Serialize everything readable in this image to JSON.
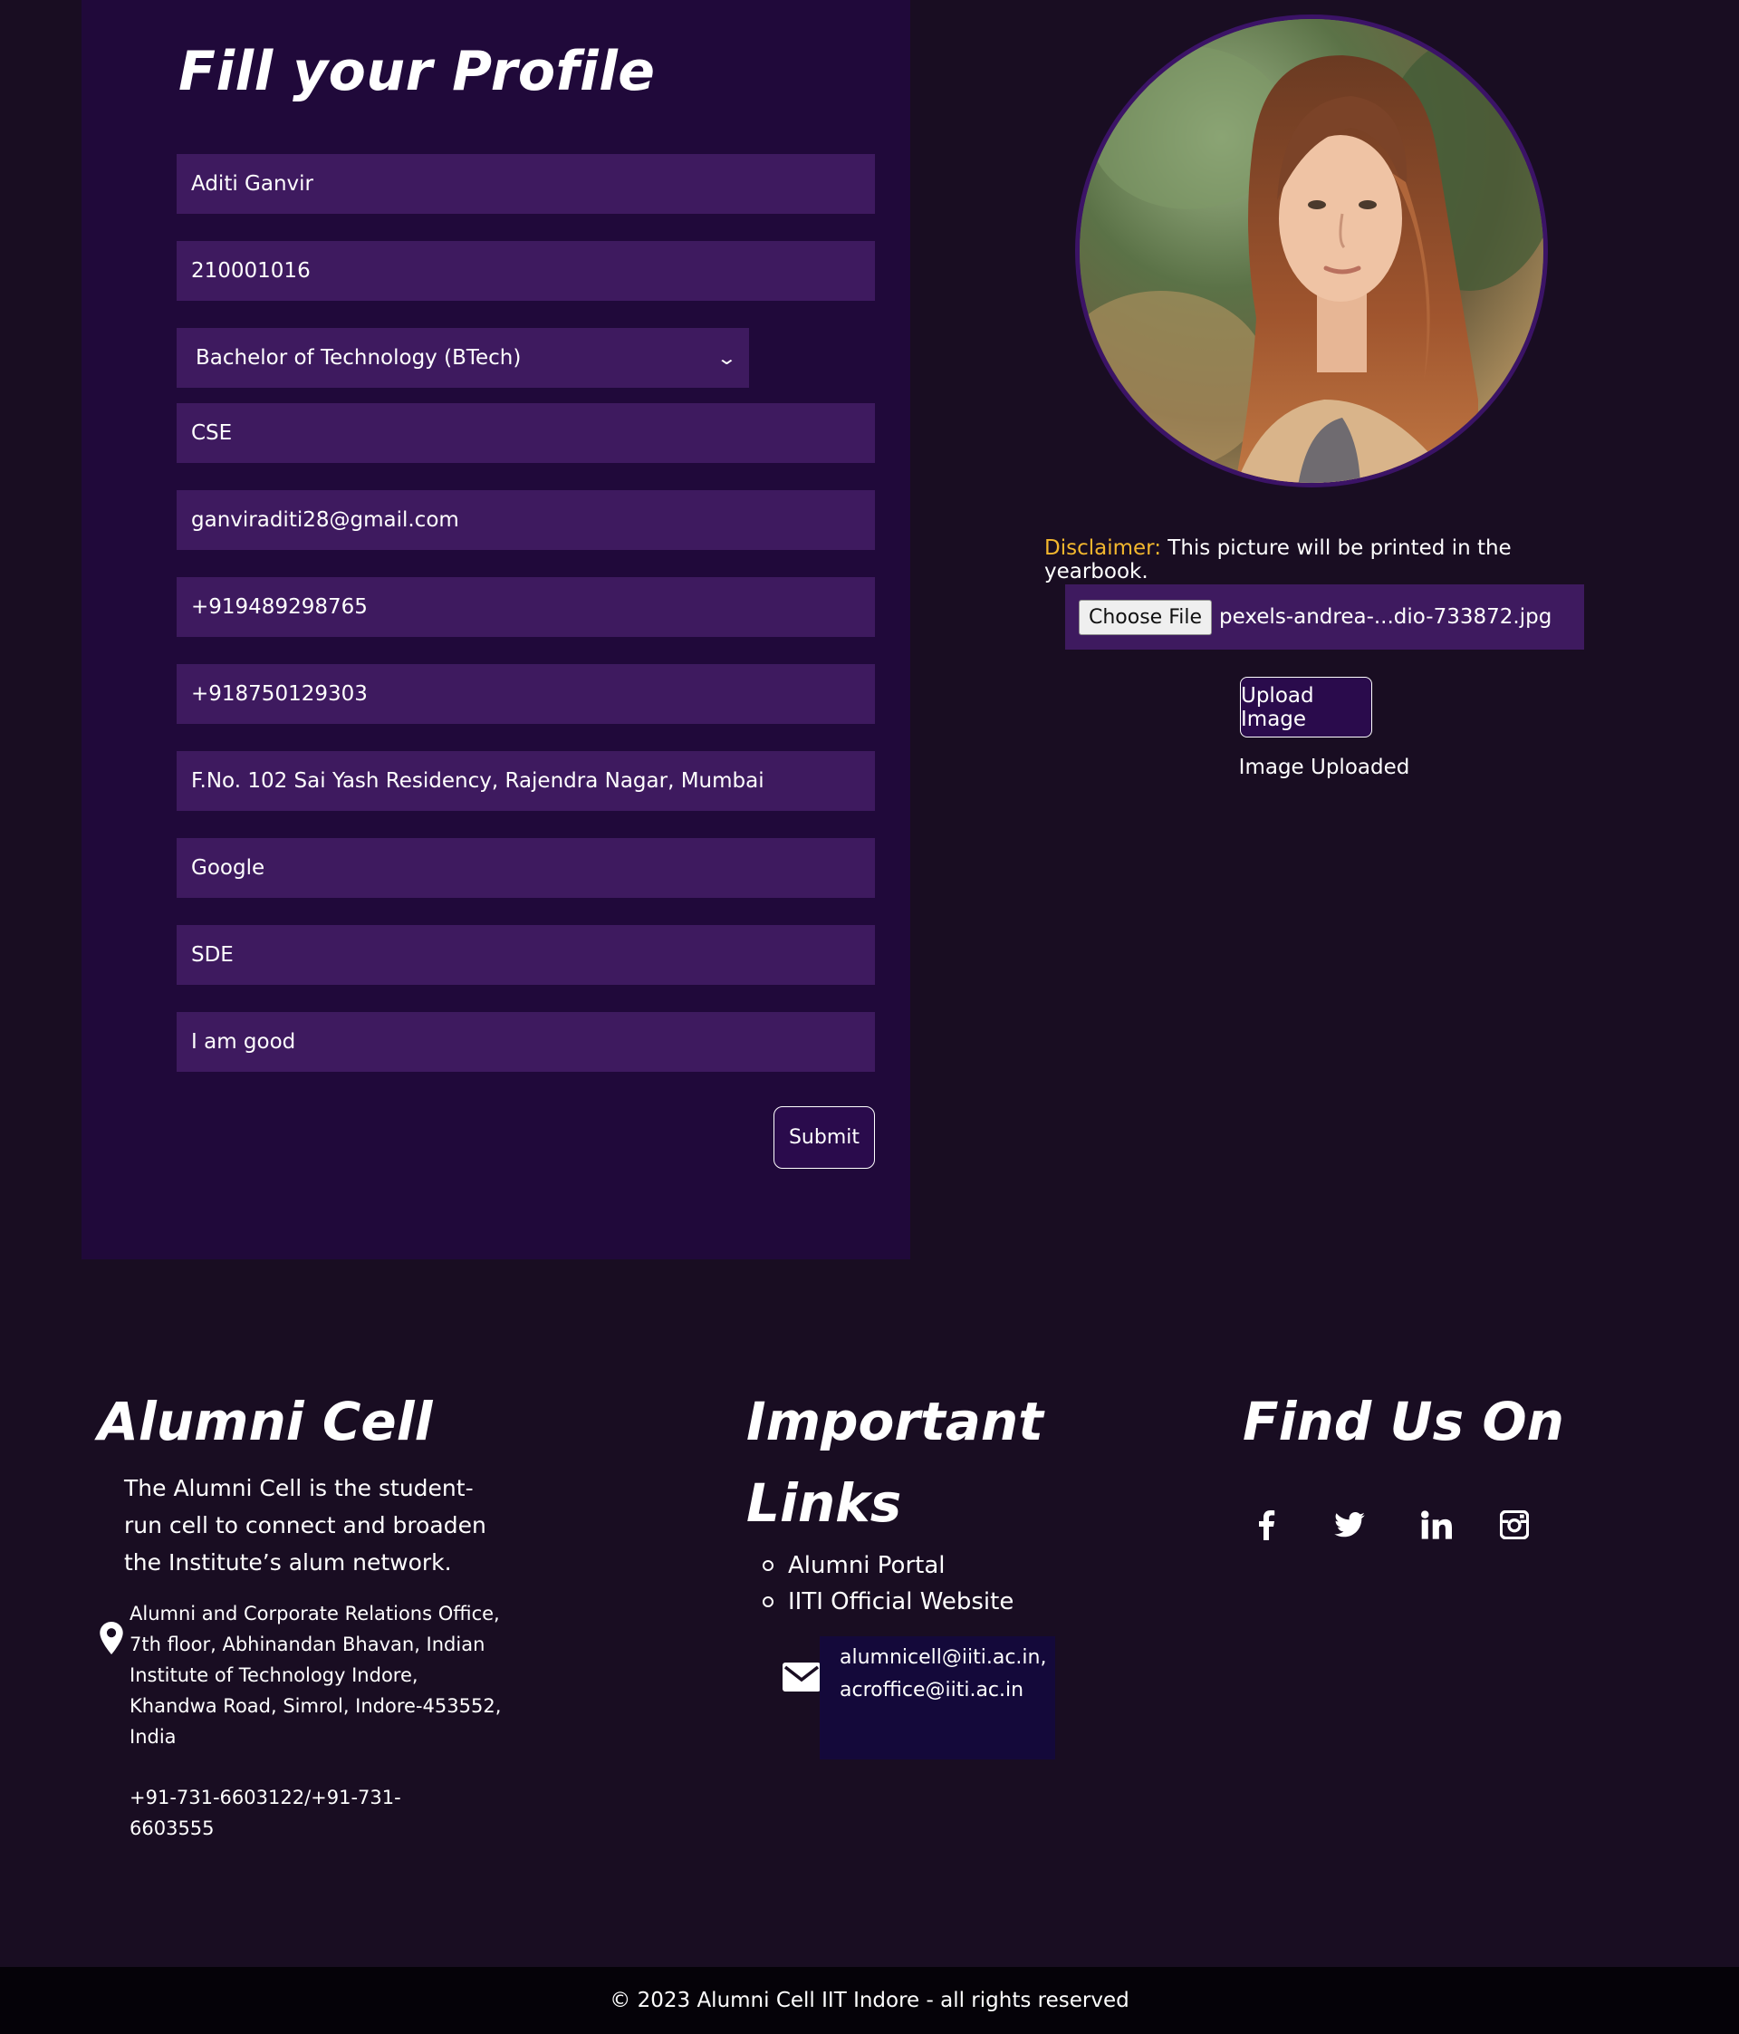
{
  "form": {
    "title": "Fill your Profile",
    "fields": {
      "name": "Aditi Ganvir",
      "roll_number": "210001016",
      "degree": "Bachelor of Technology (BTech)",
      "branch": "CSE",
      "email": "ganviraditi28@gmail.com",
      "phone": "+919489298765",
      "alt_phone": "+918750129303",
      "address": "F.No. 102 Sai Yash Residency, Rajendra Nagar, Mumbai",
      "company": "Google",
      "designation": "SDE",
      "message": "I am good"
    },
    "submit_label": "Submit"
  },
  "image_upload": {
    "disclaimer_label": "Disclaimer:",
    "disclaimer_text": " This picture will be printed in the yearbook.",
    "choose_file_label": "Choose File",
    "file_name": "pexels-andrea-...dio-733872.jpg",
    "upload_label": "Upload Image",
    "status": "Image Uploaded"
  },
  "footer": {
    "about": {
      "heading": "Alumni Cell",
      "text": "The Alumni Cell is the student-run cell to connect and broaden the Institute’s alum network.",
      "address": "Alumni and Corporate Relations Office, 7th floor, Abhinandan Bhavan, Indian Institute of Technology Indore, Khandwa Road, Simrol, Indore-453552, India",
      "phone": "+91-731-6603122/+91-731-6603555"
    },
    "links": {
      "heading_line1": "Important",
      "heading_line2": "Links",
      "items": [
        "Alumni Portal",
        "IITI Official Website"
      ],
      "email_1": "alumnicell@iiti.ac.in,",
      "email_2": "acroffice@iiti.ac.in"
    },
    "social": {
      "heading": "Find Us On",
      "icons": [
        "facebook-icon",
        "twitter-icon",
        "linkedin-icon",
        "instagram-icon"
      ]
    },
    "copyright": "© 2023 Alumni Cell IIT Indore - all rights reserved"
  },
  "colors": {
    "page_bg": "#190d22",
    "panel_bg": "#20093a",
    "field_bg": "#3e1a5f",
    "accent_yellow": "#f3b72e",
    "footer_bar": "#050208"
  }
}
